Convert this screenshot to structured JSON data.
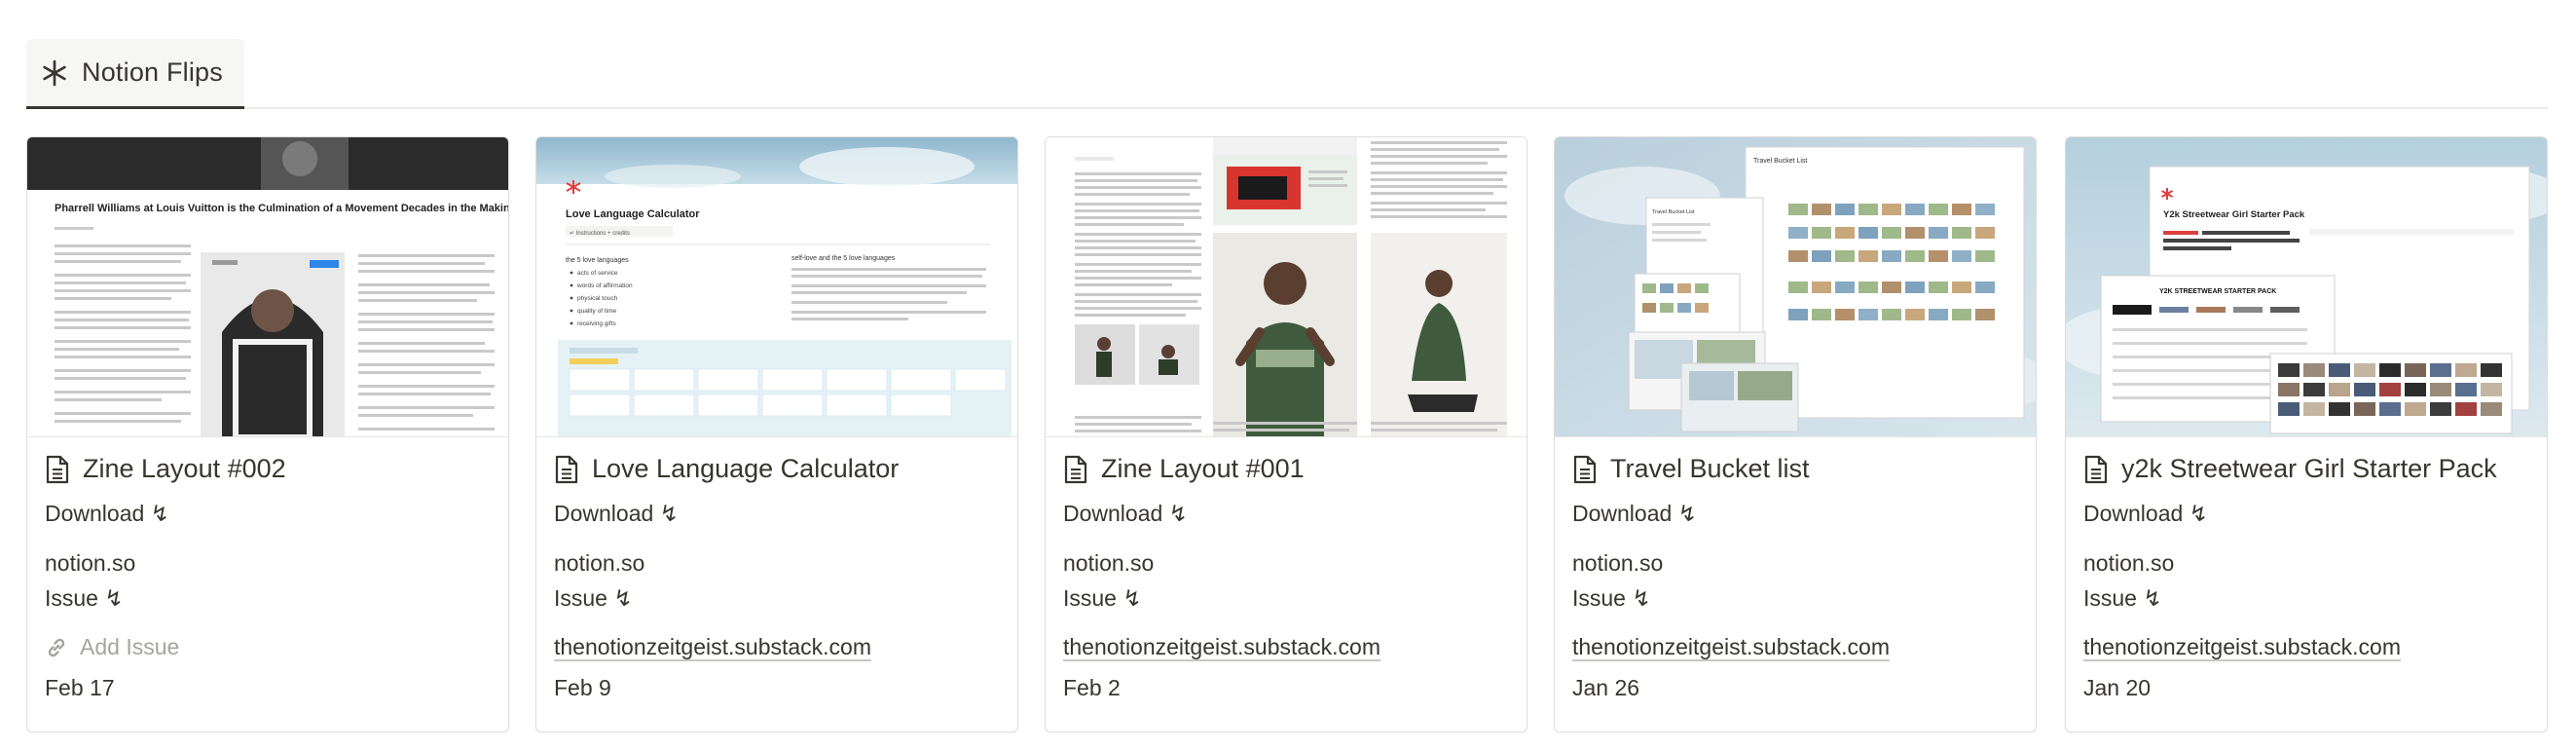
{
  "tab": {
    "label": "Notion Flips",
    "icon": "asterisk-icon"
  },
  "cards": [
    {
      "title": "Zine Layout #002",
      "download": "Download ↯",
      "domain": "notion.so",
      "issue": "Issue ↯",
      "add_issue": "Add Issue",
      "date": "Feb 17",
      "cover": {
        "headline": "Pharrell Williams at Louis Vuitton is the Culmination of a Movement Decades in the Making"
      }
    },
    {
      "title": "Love Language Calculator",
      "download": "Download ↯",
      "domain": "notion.so",
      "issue": "Issue ↯",
      "source": "thenotionzeitgeist.substack.com",
      "date": "Feb 9",
      "cover": {
        "heading": "Love Language Calculator",
        "subtitle": "↵ Instructions + credits",
        "list_title": "the 5 love languages",
        "list": [
          "acts of service",
          "words of affirmation",
          "physical touch",
          "quality of time",
          "receiving gifts"
        ],
        "right_title": "self-love and the 5 love languages"
      }
    },
    {
      "title": "Zine Layout #001",
      "download": "Download ↯",
      "domain": "notion.so",
      "issue": "Issue ↯",
      "source": "thenotionzeitgeist.substack.com",
      "date": "Feb 2"
    },
    {
      "title": "Travel Bucket list",
      "download": "Download ↯",
      "domain": "notion.so",
      "issue": "Issue ↯",
      "source": "thenotionzeitgeist.substack.com",
      "date": "Jan 26",
      "cover": {
        "label_main": "Travel Bucket List",
        "label_small": "Travel Bucket List"
      }
    },
    {
      "title": "y2k Streetwear Girl Starter Pack",
      "download": "Download ↯",
      "domain": "notion.so",
      "issue": "Issue ↯",
      "source": "thenotionzeitgeist.substack.com",
      "date": "Jan 20",
      "cover": {
        "heading": "Y2k Streetwear Girl Starter Pack",
        "banner": "Y2K STREETWEAR STARTER PACK"
      }
    }
  ],
  "colors": {
    "accent": "#e03e3e",
    "sky": "#a9c9da",
    "text": "#37352f",
    "muted": "#a5a4a0"
  }
}
